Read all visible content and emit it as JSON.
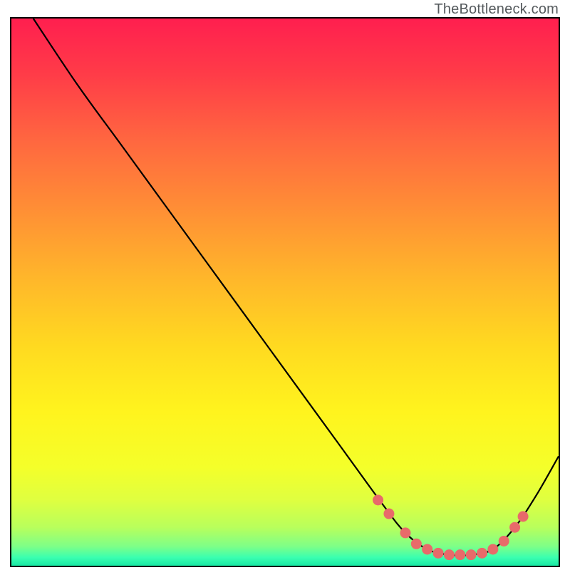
{
  "watermark": "TheBottleneck.com",
  "chart_data": {
    "type": "line",
    "title": "",
    "xlabel": "",
    "ylabel": "",
    "xlim": [
      0,
      100
    ],
    "ylim": [
      0,
      100
    ],
    "curve": {
      "name": "bottleneck-curve",
      "points": [
        {
          "x": 4,
          "y": 100
        },
        {
          "x": 12,
          "y": 88
        },
        {
          "x": 20,
          "y": 77
        },
        {
          "x": 28,
          "y": 66
        },
        {
          "x": 36,
          "y": 55
        },
        {
          "x": 44,
          "y": 44
        },
        {
          "x": 52,
          "y": 33
        },
        {
          "x": 60,
          "y": 22
        },
        {
          "x": 68,
          "y": 11
        },
        {
          "x": 72,
          "y": 6
        },
        {
          "x": 76,
          "y": 3
        },
        {
          "x": 80,
          "y": 2
        },
        {
          "x": 84,
          "y": 2
        },
        {
          "x": 88,
          "y": 3
        },
        {
          "x": 92,
          "y": 7
        },
        {
          "x": 96,
          "y": 13
        },
        {
          "x": 100,
          "y": 20
        }
      ]
    },
    "markers": {
      "name": "highlighted-points",
      "color": "#e86a6a",
      "points": [
        {
          "x": 67,
          "y": 12
        },
        {
          "x": 69,
          "y": 9.5
        },
        {
          "x": 72,
          "y": 6
        },
        {
          "x": 74,
          "y": 4
        },
        {
          "x": 76,
          "y": 3
        },
        {
          "x": 78,
          "y": 2.3
        },
        {
          "x": 80,
          "y": 2
        },
        {
          "x": 82,
          "y": 2
        },
        {
          "x": 84,
          "y": 2
        },
        {
          "x": 86,
          "y": 2.3
        },
        {
          "x": 88,
          "y": 3
        },
        {
          "x": 90,
          "y": 4.5
        },
        {
          "x": 92,
          "y": 7
        },
        {
          "x": 93.5,
          "y": 9
        }
      ]
    },
    "background_gradient": {
      "stops": [
        {
          "offset": 0.0,
          "color": "#ff1f4f"
        },
        {
          "offset": 0.1,
          "color": "#ff3b48"
        },
        {
          "offset": 0.22,
          "color": "#ff6640"
        },
        {
          "offset": 0.35,
          "color": "#ff8f35"
        },
        {
          "offset": 0.48,
          "color": "#ffb82a"
        },
        {
          "offset": 0.6,
          "color": "#ffda20"
        },
        {
          "offset": 0.72,
          "color": "#fff41e"
        },
        {
          "offset": 0.82,
          "color": "#f4ff2a"
        },
        {
          "offset": 0.88,
          "color": "#dfff40"
        },
        {
          "offset": 0.93,
          "color": "#b8ff5c"
        },
        {
          "offset": 0.965,
          "color": "#7dff88"
        },
        {
          "offset": 0.985,
          "color": "#3affb0"
        },
        {
          "offset": 1.0,
          "color": "#18e8a4"
        }
      ]
    }
  }
}
